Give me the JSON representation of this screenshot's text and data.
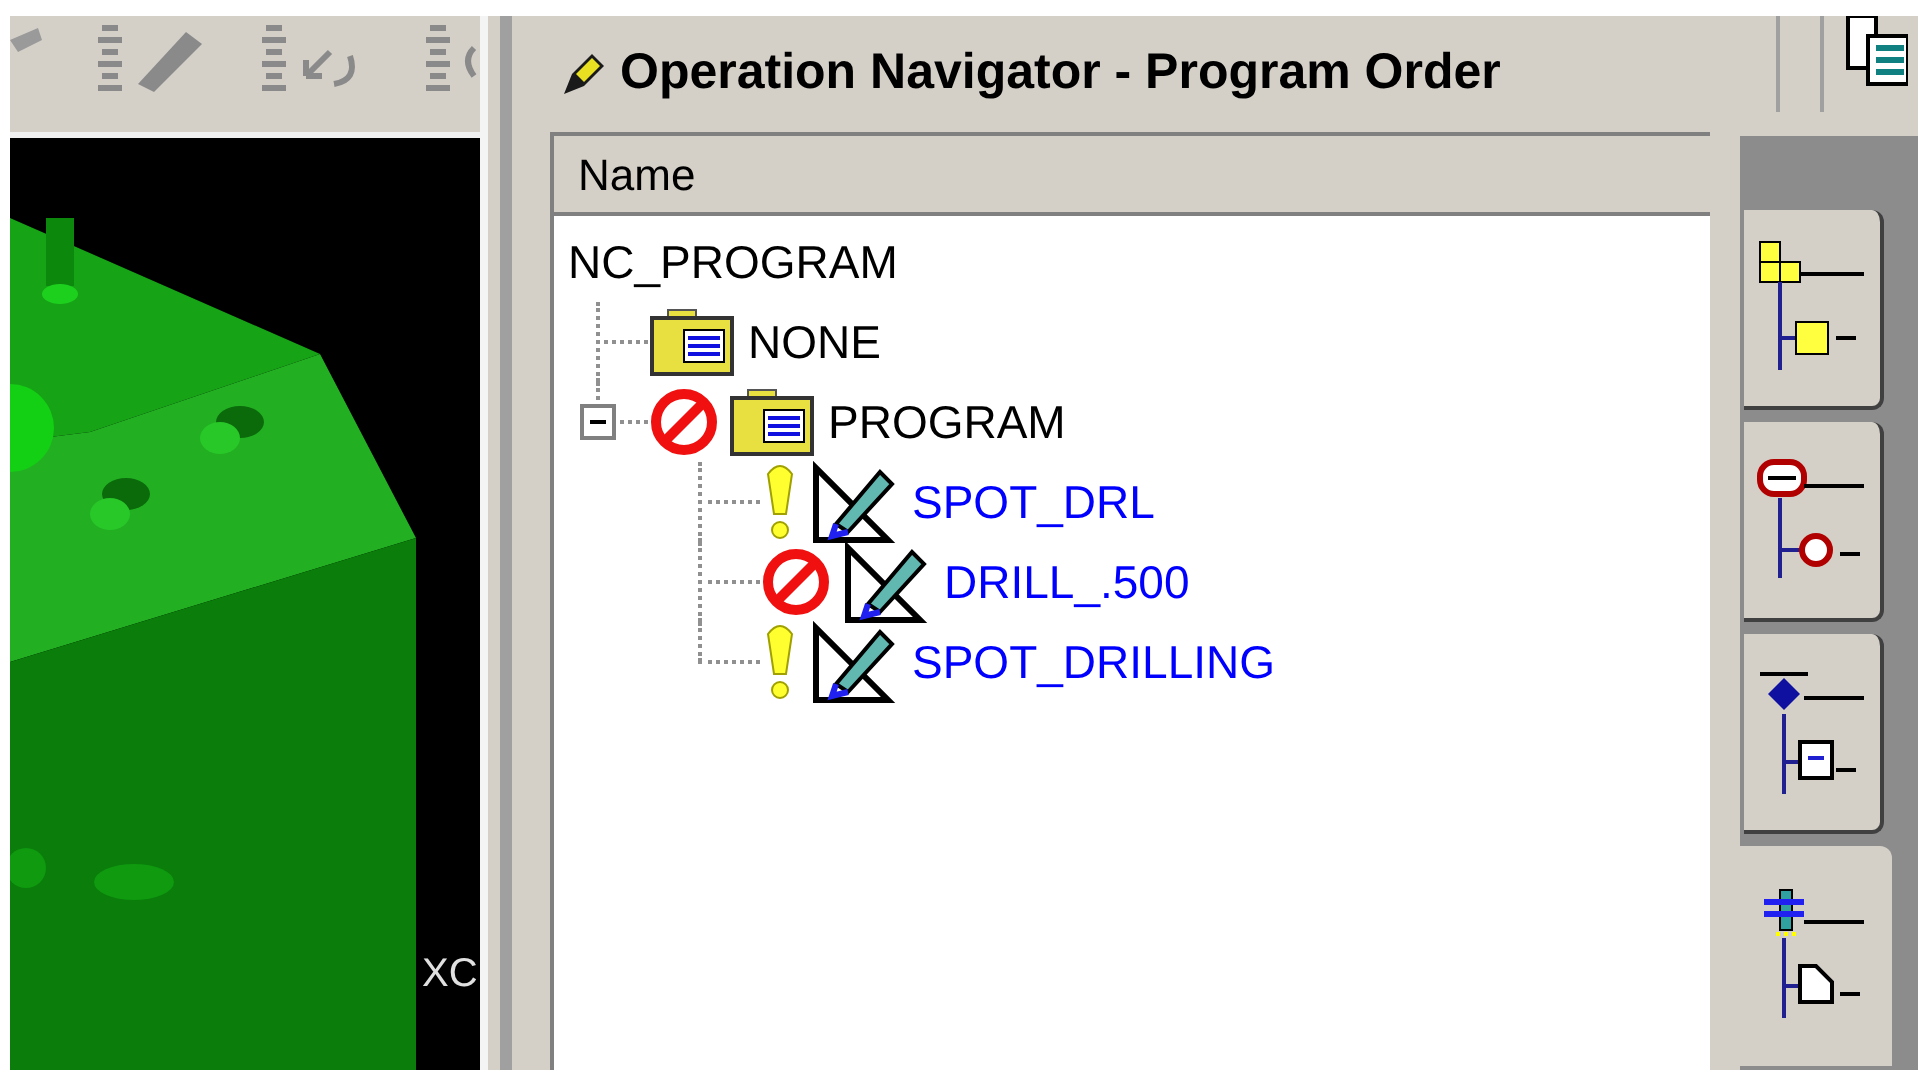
{
  "navigator": {
    "title": "Operation Navigator - Program Order",
    "column_header": "Name",
    "tree": {
      "label": "NC_PROGRAM",
      "children": [
        {
          "label": "NONE",
          "kind": "group",
          "blocked": false,
          "warning": false
        },
        {
          "label": "PROGRAM",
          "kind": "group",
          "blocked": true,
          "warning": false,
          "expanded": true,
          "children": [
            {
              "label": "SPOT_DRL",
              "kind": "operation",
              "blocked": false,
              "warning": true
            },
            {
              "label": "DRILL_.500",
              "kind": "operation",
              "blocked": true,
              "warning": false
            },
            {
              "label": "SPOT_DRILLING",
              "kind": "operation",
              "blocked": false,
              "warning": true
            }
          ]
        }
      ]
    }
  },
  "viewport": {
    "axis_label": "XC"
  },
  "view_tabs": [
    {
      "selected": false
    },
    {
      "selected": false
    },
    {
      "selected": false
    },
    {
      "selected": true
    }
  ]
}
